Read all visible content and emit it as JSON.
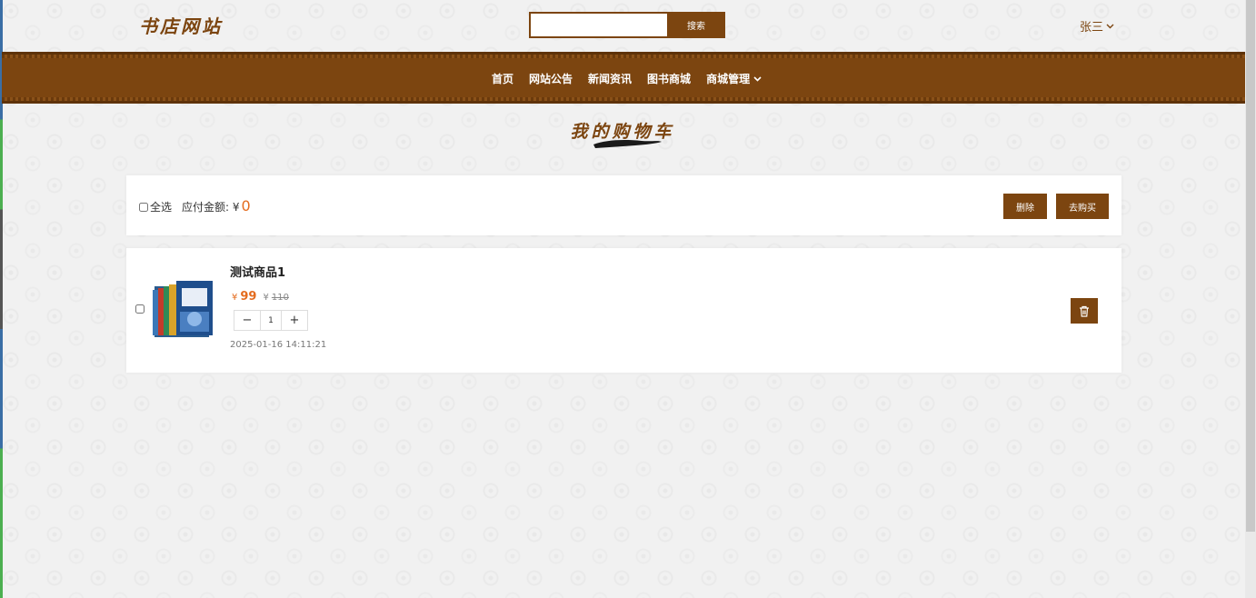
{
  "header": {
    "logo": "书店网站",
    "search_placeholder": "",
    "search_button": "搜索",
    "user_name": "张三"
  },
  "nav": {
    "items": [
      {
        "label": "首页"
      },
      {
        "label": "网站公告"
      },
      {
        "label": "新闻资讯"
      },
      {
        "label": "图书商城"
      },
      {
        "label": "商城管理",
        "has_dropdown": true
      }
    ]
  },
  "page": {
    "title": "我的购物车"
  },
  "toolbar": {
    "select_all_label": "全选",
    "amount_label": "应付金额: ¥",
    "amount_value": "0",
    "delete_button": "删除",
    "buy_button": "去购买"
  },
  "cart": {
    "items": [
      {
        "name": "测试商品1",
        "currency": "¥",
        "price": "99",
        "original_currency": "¥",
        "original_price": "110",
        "quantity": "1",
        "minus_label": "−",
        "plus_label": "+",
        "added_time": "2025-01-16 14:11:21"
      }
    ]
  },
  "colors": {
    "brand": "#7c4510",
    "price": "#e46c1f"
  },
  "icons": {
    "user_dropdown": "chevron-down-icon",
    "nav_dropdown": "chevron-down-icon",
    "remove_item": "trash-icon"
  }
}
